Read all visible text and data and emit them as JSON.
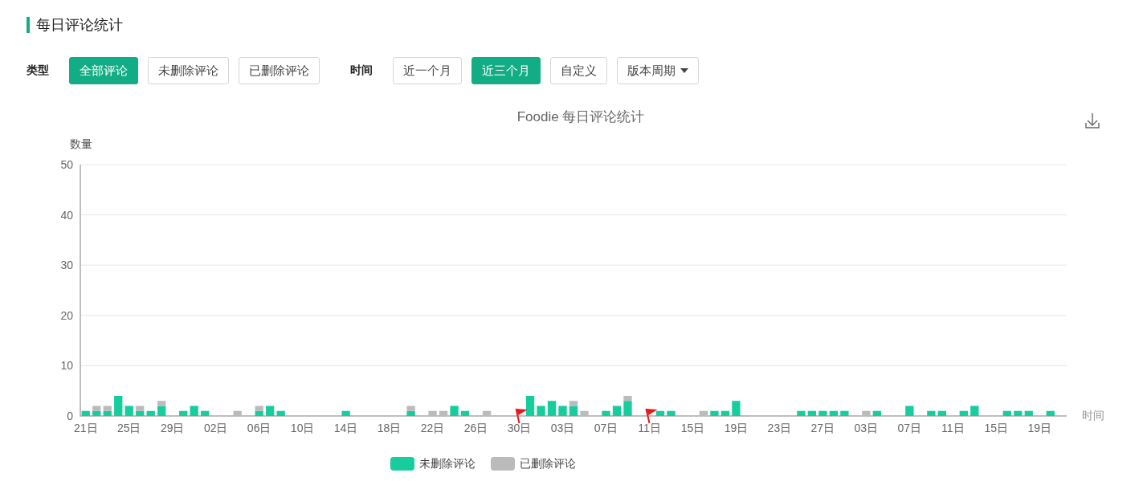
{
  "section": {
    "title": "每日评论统计"
  },
  "filters": [
    {
      "label": "类型",
      "options": [
        {
          "label": "全部评论",
          "selected": true
        },
        {
          "label": "未删除评论",
          "selected": false
        },
        {
          "label": "已删除评论",
          "selected": false
        }
      ]
    },
    {
      "label": "时间",
      "options": [
        {
          "label": "近一个月",
          "selected": false
        },
        {
          "label": "近三个月",
          "selected": true
        },
        {
          "label": "自定义",
          "selected": false
        },
        {
          "label": "版本周期",
          "selected": false,
          "dropdown": true
        }
      ]
    }
  ],
  "chart": {
    "chart_data": {
      "type": "bar",
      "title": "Foodie  每日评论统计",
      "ylabel": "数量",
      "xlabel": "时间",
      "stacked": true,
      "ylim": [
        0,
        50
      ],
      "yticks": [
        0,
        10,
        20,
        30,
        40,
        50
      ],
      "grid": true,
      "legend": "bottom",
      "categories": [
        "21日",
        null,
        null,
        null,
        "25日",
        null,
        null,
        null,
        "29日",
        null,
        null,
        null,
        "02日",
        null,
        null,
        null,
        "06日",
        null,
        null,
        null,
        "10日",
        null,
        null,
        null,
        "14日",
        null,
        null,
        null,
        "18日",
        null,
        null,
        null,
        "22日",
        null,
        null,
        null,
        "26日",
        null,
        null,
        null,
        "30日",
        null,
        null,
        null,
        "03日",
        null,
        null,
        null,
        "07日",
        null,
        null,
        null,
        "11日",
        null,
        null,
        null,
        "15日",
        null,
        null,
        null,
        "19日",
        null,
        null,
        null,
        "23日",
        null,
        null,
        null,
        "27日",
        null,
        null,
        null,
        "03日",
        null,
        null,
        null,
        "07日",
        null,
        null,
        null,
        "11日",
        null,
        null,
        null,
        "15日",
        null,
        null,
        null,
        "19日",
        null,
        null
      ],
      "series": [
        {
          "name": "未删除评论",
          "color": "#17cc9d",
          "values": [
            1,
            1,
            1,
            4,
            2,
            1,
            1,
            2,
            0,
            1,
            2,
            1,
            0,
            0,
            0,
            0,
            1,
            2,
            1,
            0,
            0,
            0,
            0,
            0,
            1,
            0,
            0,
            0,
            0,
            0,
            1,
            0,
            0,
            0,
            2,
            1,
            0,
            0,
            0,
            0,
            0,
            4,
            2,
            3,
            2,
            2,
            0,
            0,
            1,
            2,
            3,
            0,
            0,
            1,
            1,
            0,
            0,
            0,
            1,
            1,
            3,
            0,
            0,
            0,
            0,
            0,
            1,
            1,
            1,
            1,
            1,
            0,
            0,
            1,
            0,
            0,
            2,
            0,
            1,
            1,
            0,
            1,
            2,
            0,
            0,
            1,
            1,
            1,
            0,
            1,
            0
          ]
        },
        {
          "name": "已删除评论",
          "color": "#bbbbbb",
          "values": [
            0,
            1,
            1,
            0,
            0,
            1,
            0,
            1,
            0,
            0,
            0,
            0,
            0,
            0,
            1,
            0,
            1,
            0,
            0,
            0,
            0,
            0,
            0,
            0,
            0,
            0,
            0,
            0,
            0,
            0,
            1,
            0,
            1,
            1,
            0,
            0,
            0,
            1,
            0,
            0,
            0,
            0,
            0,
            0,
            0,
            1,
            1,
            0,
            0,
            0,
            1,
            0,
            0,
            0,
            0,
            0,
            0,
            1,
            0,
            0,
            0,
            0,
            0,
            0,
            0,
            0,
            0,
            0,
            0,
            0,
            0,
            0,
            1,
            0,
            0,
            0,
            0,
            0,
            0,
            0,
            0,
            0,
            0,
            0,
            0,
            0,
            0,
            0,
            0,
            0,
            0
          ]
        }
      ],
      "annotations": [
        {
          "x": "30日"
        },
        {
          "x": "11日"
        }
      ]
    }
  }
}
